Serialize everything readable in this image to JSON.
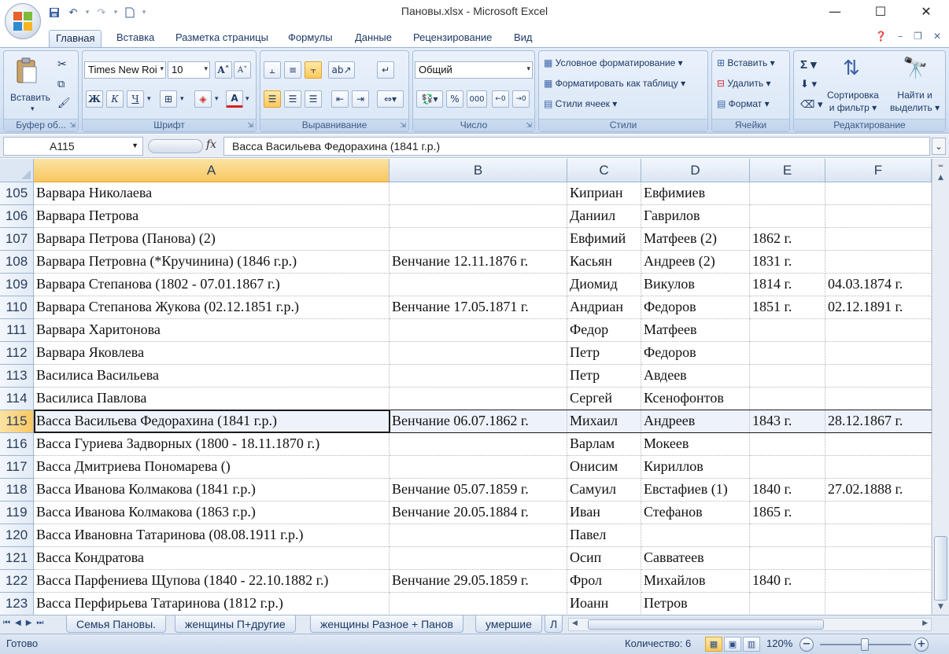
{
  "window": {
    "title": "Пановы.xlsx - Microsoft Excel",
    "minimize_icon": "minimize-icon",
    "maximize_icon": "maximize-icon",
    "close_icon": "close-icon"
  },
  "ribbon_tabs": [
    "Главная",
    "Вставка",
    "Разметка страницы",
    "Формулы",
    "Данные",
    "Рецензирование",
    "Вид"
  ],
  "active_tab": "Главная",
  "ribbon": {
    "clipboard": {
      "label": "Буфер об...",
      "paste": "Вставить"
    },
    "font": {
      "label": "Шрифт",
      "font_name": "Times New Roi",
      "font_size": "10",
      "bold": "Ж",
      "italic": "К",
      "underline": "Ч"
    },
    "alignment": {
      "label": "Выравнивание"
    },
    "number": {
      "label": "Число",
      "format": "Общий",
      "percent": "%",
      "thousands": "000"
    },
    "styles": {
      "label": "Стили",
      "conditional": "Условное форматирование",
      "as_table": "Форматировать как таблицу",
      "cell_styles": "Стили ячеек"
    },
    "cells": {
      "label": "Ячейки",
      "insert": "Вставить",
      "delete": "Удалить",
      "format": "Формат"
    },
    "editing": {
      "label": "Редактирование",
      "sort_filter_1": "Сортировка",
      "sort_filter_2": "и фильтр",
      "find_select_1": "Найти и",
      "find_select_2": "выделить"
    }
  },
  "formula_bar": {
    "name_box": "A115",
    "fx": "fx",
    "value": "Васса Васильева Федорахина (1841 г.р.)"
  },
  "columns": [
    "A",
    "B",
    "C",
    "D",
    "E",
    "F"
  ],
  "selected_row": "115",
  "rows": [
    {
      "n": "105",
      "a": "Варвара Николаева",
      "b": "",
      "c": "Киприан",
      "d": "Евфимиев",
      "e": "",
      "f": ""
    },
    {
      "n": "106",
      "a": "Варвара Петрова",
      "b": "",
      "c": "Даниил",
      "d": "Гаврилов",
      "e": "",
      "f": ""
    },
    {
      "n": "107",
      "a": "Варвара Петрова (Панова) (2)",
      "b": "",
      "c": "Евфимий",
      "d": "Матфеев (2)",
      "e": "1862 г.",
      "f": ""
    },
    {
      "n": "108",
      "a": "Варвара Петровна (*Кручинина) (1846 г.р.)",
      "b": "Венчание 12.11.1876 г.",
      "c": "Касьян",
      "d": "Андреев (2)",
      "e": "1831 г.",
      "f": ""
    },
    {
      "n": "109",
      "a": "Варвара Степанова (1802 - 07.01.1867 г.)",
      "b": "",
      "c": "Диомид",
      "d": "Викулов",
      "e": "1814 г.",
      "f": "04.03.1874 г."
    },
    {
      "n": "110",
      "a": "Варвара Степанова Жукова (02.12.1851 г.р.)",
      "b": "Венчание 17.05.1871 г.",
      "c": "Андриан",
      "d": "Федоров",
      "e": "1851 г.",
      "f": "02.12.1891 г."
    },
    {
      "n": "111",
      "a": "Варвара Харитонова",
      "b": "",
      "c": "Федор",
      "d": "Матфеев",
      "e": "",
      "f": ""
    },
    {
      "n": "112",
      "a": "Варвара Яковлева",
      "b": "",
      "c": "Петр",
      "d": "Федоров",
      "e": "",
      "f": ""
    },
    {
      "n": "113",
      "a": "Василиса Васильева",
      "b": "",
      "c": "Петр",
      "d": "Авдеев",
      "e": "",
      "f": ""
    },
    {
      "n": "114",
      "a": "Василиса Павлова",
      "b": "",
      "c": "Сергей",
      "d": "Ксенофонтов",
      "e": "",
      "f": ""
    },
    {
      "n": "115",
      "a": "Васса Васильева Федорахина (1841 г.р.)",
      "b": "Венчание 06.07.1862 г.",
      "c": "Михаил",
      "d": "Андреев",
      "e": "1843 г.",
      "f": "28.12.1867 г."
    },
    {
      "n": "116",
      "a": "Васса Гуриева Задворных (1800 - 18.11.1870 г.)",
      "b": "",
      "c": "Варлам",
      "d": "Мокеев",
      "e": "",
      "f": ""
    },
    {
      "n": "117",
      "a": "Васса Дмитриева Пономарева ()",
      "b": "",
      "c": "Онисим",
      "d": "Кириллов",
      "e": "",
      "f": ""
    },
    {
      "n": "118",
      "a": "Васса Иванова Колмакова (1841 г.р.)",
      "b": "Венчание 05.07.1859 г.",
      "c": "Самуил",
      "d": "Евстафиев (1)",
      "e": "1840 г.",
      "f": "27.02.1888 г."
    },
    {
      "n": "119",
      "a": "Васса Иванова Колмакова (1863 г.р.)",
      "b": "Венчание 20.05.1884 г.",
      "c": "Иван",
      "d": "Стефанов",
      "e": "1865 г.",
      "f": ""
    },
    {
      "n": "120",
      "a": "Васса Ивановна Татаринова (08.08.1911 г.р.)",
      "b": "",
      "c": "Павел",
      "d": "",
      "e": "",
      "f": ""
    },
    {
      "n": "121",
      "a": "Васса Кондратова",
      "b": "",
      "c": "Осип",
      "d": "Савватеев",
      "e": "",
      "f": ""
    },
    {
      "n": "122",
      "a": "Васса Парфениева Щупова (1840 - 22.10.1882 г.)",
      "b": "Венчание 29.05.1859 г.",
      "c": "Фрол",
      "d": "Михайлов",
      "e": "1840 г.",
      "f": ""
    },
    {
      "n": "123",
      "a": "Васса Перфирьева Татаринова (1812 г.р.)",
      "b": "",
      "c": "Иоанн",
      "d": "Петров",
      "e": "",
      "f": ""
    }
  ],
  "sheet_tabs": [
    "Семья Пановы.",
    "женщины П+другие",
    "женщины Разное + Панов",
    "умершие",
    "Л"
  ],
  "status": {
    "ready": "Готово",
    "count": "Количество: 6",
    "zoom": "120%"
  },
  "colors": {
    "ribbon": "#d6e3f4",
    "selection": "#f9c760",
    "accent": "#1e3a66"
  }
}
